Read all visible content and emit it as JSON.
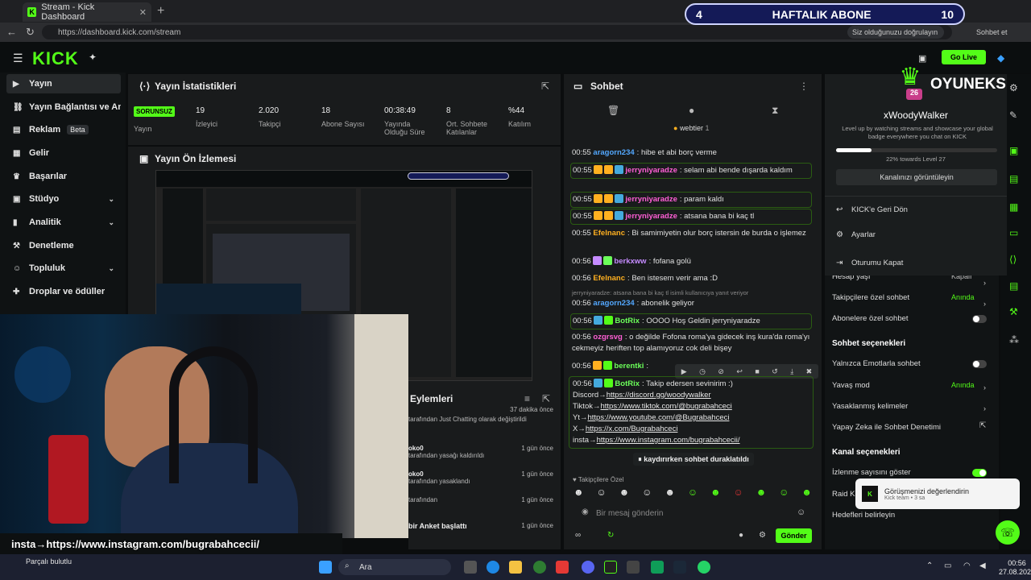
{
  "browser": {
    "tab_title": "Stream - Kick Dashboard",
    "url": "https://dashboard.kick.com/stream",
    "sync_label": "Siz olduğunuzu doğrulayın",
    "share_label": "Sohbet et"
  },
  "sub_overlay": {
    "left": "4",
    "label": "HAFTALIK ABONE",
    "right": "10"
  },
  "header": {
    "logo": "KICK",
    "go_live": "Go Live"
  },
  "sidebar": {
    "items": [
      {
        "label": "Yayın",
        "icon": "play-icon"
      },
      {
        "label": "Yayın Bağlantısı ve Anahtarı",
        "icon": "link-icon"
      },
      {
        "label": "Reklam",
        "icon": "ad-icon",
        "badge": "Beta"
      },
      {
        "label": "Gelir",
        "icon": "wallet-icon"
      },
      {
        "label": "Başarılar",
        "icon": "trophy-icon"
      },
      {
        "label": "Stüdyo",
        "icon": "studio-icon"
      },
      {
        "label": "Analitik",
        "icon": "chart-icon"
      },
      {
        "label": "Denetleme",
        "icon": "hammer-icon"
      },
      {
        "label": "Topluluk",
        "icon": "community-icon"
      },
      {
        "label": "Droplar ve ödüller",
        "icon": "gift-icon"
      }
    ]
  },
  "stats": {
    "title": "Yayın İstatistikleri",
    "status_badge": "SORUNSUZ",
    "items": [
      {
        "value": "",
        "label": "Yayın"
      },
      {
        "value": "19",
        "label": "İzleyici"
      },
      {
        "value": "2.020",
        "label": "Takipçi"
      },
      {
        "value": "18",
        "label": "Abone Sayısı"
      },
      {
        "value": "00:38:49",
        "label": "Yayında Olduğu Süre"
      },
      {
        "value": "8",
        "label": "Ort. Sohbete Katılanlar"
      },
      {
        "value": "%44",
        "label": "Katılım"
      }
    ]
  },
  "preview": {
    "title": "Yayın Ön İzlemesi"
  },
  "actions": {
    "title": "Eylemleri",
    "rows": [
      {
        "text": "tarafından Just Chatting olarak değiştirildi",
        "time": "37 dakika önce"
      },
      {
        "user": "oko0",
        "text": "tarafından yasağı kaldırıldı",
        "time": "1 gün önce"
      },
      {
        "user": "oko0",
        "text": "tarafından yasaklandı",
        "time": "1 gün önce"
      },
      {
        "user": "",
        "text": "tarafından",
        "time": "1 gün önce"
      },
      {
        "user": "",
        "text": "bir Anket başlattı",
        "time": "1 gün önce"
      }
    ]
  },
  "chat": {
    "title": "Sohbet",
    "pinned_label": "webtier",
    "pinned_count": "1",
    "messages": [
      {
        "time": "00:55",
        "user": "aragorn234",
        "color": "u1",
        "text": "hibe et abi borç verme"
      },
      {
        "time": "00:55",
        "user": "jerryniyaradze",
        "color": "u2",
        "text": "selam abi bende dışarda kaldım",
        "hl": true
      },
      {
        "time": "00:55",
        "user": "jerryniyaradze",
        "color": "u2",
        "text": "param kaldı",
        "hl": true
      },
      {
        "time": "00:55",
        "user": "jerryniyaradze",
        "color": "u2",
        "text": "atsana bana bi kaç tl",
        "hl": true
      },
      {
        "time": "00:55",
        "user": "Efelnanc",
        "color": "u3",
        "text": "Bi samimiyetin olur borç istersin de burda o işlemez"
      },
      {
        "time": "00:56",
        "user": "berkxww",
        "color": "u5",
        "text": "fofana golü"
      },
      {
        "time": "00:56",
        "user": "Efelnanc",
        "color": "u3",
        "text": "Ben istesem verir ama :D"
      },
      {
        "time": "00:56",
        "user": "aragorn234",
        "color": "u1",
        "text": "abonelik geliyor"
      },
      {
        "time": "00:56",
        "user": "BotRix",
        "color": "u4",
        "text": "OOOO Hoş Geldin jerryniyaradze",
        "hl": true
      },
      {
        "time": "00:56",
        "user": "ozgrsvg",
        "color": "u2",
        "text": "o değilde Fofona roma'ya gidecek inş kura'da roma'yı cekmeyiz heriften top alamıyoruz cok deli bişey"
      },
      {
        "time": "00:56",
        "user": "berentki",
        "color": "u4",
        "text": ""
      }
    ],
    "reply_hint": "jerryniyaradze: atsana bana bi kaç tl isimli kullanıcıya yanıt veriyor",
    "botrix": {
      "time": "00:56",
      "user": "BotRix",
      "intro": "Takip edersen sevinirim :)",
      "lines": [
        {
          "label": "Discord→",
          "link": "https://discord.gg/woodywalker"
        },
        {
          "label": "Tiktok→",
          "link": "https://www.tiktok.com/@bugrabahceci"
        },
        {
          "label": "Yt→",
          "link": "https://www.youtube.com/@Bugrabahceci"
        },
        {
          "label": "X→",
          "link": "https://x.com/Bugrabahceci"
        },
        {
          "label": "insta→",
          "link": "https://www.instagram.com/bugrabahcecii/"
        }
      ]
    },
    "paused": "kaydırırken sohbet duraklatıldı",
    "followers_only": "Takipçilere Özel",
    "input_placeholder": "Bir mesaj gönderin",
    "send": "Gönder"
  },
  "profile": {
    "brand": "OYUNEKS",
    "username": "xWoodyWalker",
    "level": "26",
    "blurb": "Level up by watching streams and showcase your global badge everywhere you chat on KICK",
    "xp_text": "22% towards Level 27",
    "xp_fraction": 0.22,
    "channel_btn": "Kanalınızı görüntüleyin",
    "menu": [
      "KICK'e Geri Dön",
      "Ayarlar",
      "Oturumu Kapat"
    ]
  },
  "settings": {
    "rows_top": [
      {
        "label": "Hesap yaşı",
        "value": "Kapalı"
      },
      {
        "label": "Takipçilere özel sohbet",
        "value": "Anında"
      },
      {
        "label": "Abonelere özel sohbet",
        "toggle": false
      }
    ],
    "chat_head": "Sohbet seçenekleri",
    "chat_rows": [
      {
        "label": "Yalnızca Emotlarla sohbet",
        "toggle": false
      },
      {
        "label": "Yavaş mod",
        "value": "Anında"
      },
      {
        "label": "Yasaklanmış kelimeler"
      },
      {
        "label": "Yapay Zeka ile Sohbet Denetimi"
      }
    ],
    "channel_head": "Kanal seçenekleri",
    "channel_rows": [
      {
        "label": "İzlenme sayısını göster",
        "toggle": true
      },
      {
        "label": "Raid Ka"
      },
      {
        "label": "Hedefleri belirleyin"
      }
    ]
  },
  "toast": {
    "title": "Görüşmenizi değerlendirin",
    "sub": "Kick team • 3 sa"
  },
  "overlay": {
    "caption": "insta→https://www.instagram.com/bugrabahcecii/",
    "kick_user": "berkxww",
    "kick_count": ": 8"
  },
  "taskbar": {
    "weather": "Parçalı bulutlu",
    "search": "Ara",
    "time": "00:56",
    "date": "27.08.2025"
  }
}
